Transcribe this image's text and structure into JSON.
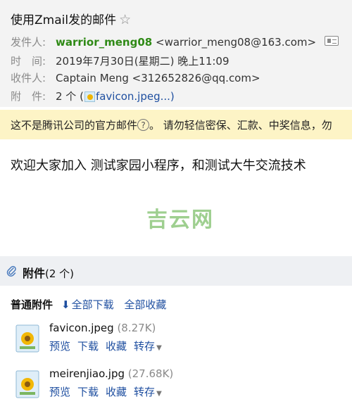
{
  "email": {
    "subject": "使用Zmail发的邮件",
    "star_icon": "star-outline-icon",
    "from": {
      "label": "发件人:",
      "name": "warrior_meng08",
      "email": "<warrior_meng08@163.com>"
    },
    "time": {
      "label": "时　间:",
      "value": "2019年7月30日(星期二) 晚上11:09"
    },
    "to": {
      "label": "收件人:",
      "value": "Captain Meng <312652826@qq.com>"
    },
    "attachments_summary": {
      "label": "附　件:",
      "count_text": "2 个 (",
      "file_link": "favicon.jpeg...)"
    }
  },
  "warning": {
    "text": "这不是腾讯公司的官方邮件",
    "qmark": "?",
    "advice": "。  请勿轻信密保、汇款、中奖信息，勿"
  },
  "body": {
    "text": "欢迎大家加入 测试家园小程序，和测试大牛交流技术",
    "watermark": "吉云网"
  },
  "attachments": {
    "title": "附件",
    "count": "(2 个)",
    "normal_label": "普通附件",
    "download_all": "全部下载",
    "favorite_all": "全部收藏",
    "files": [
      {
        "name": "favicon.jpeg",
        "size": "(8.27K)",
        "preview": "预览",
        "download": "下载",
        "favorite": "收藏",
        "forward": "转存"
      },
      {
        "name": "meirenjiao.jpg",
        "size": "(27.68K)",
        "preview": "预览",
        "download": "下载",
        "favorite": "收藏",
        "forward": "转存"
      }
    ]
  }
}
